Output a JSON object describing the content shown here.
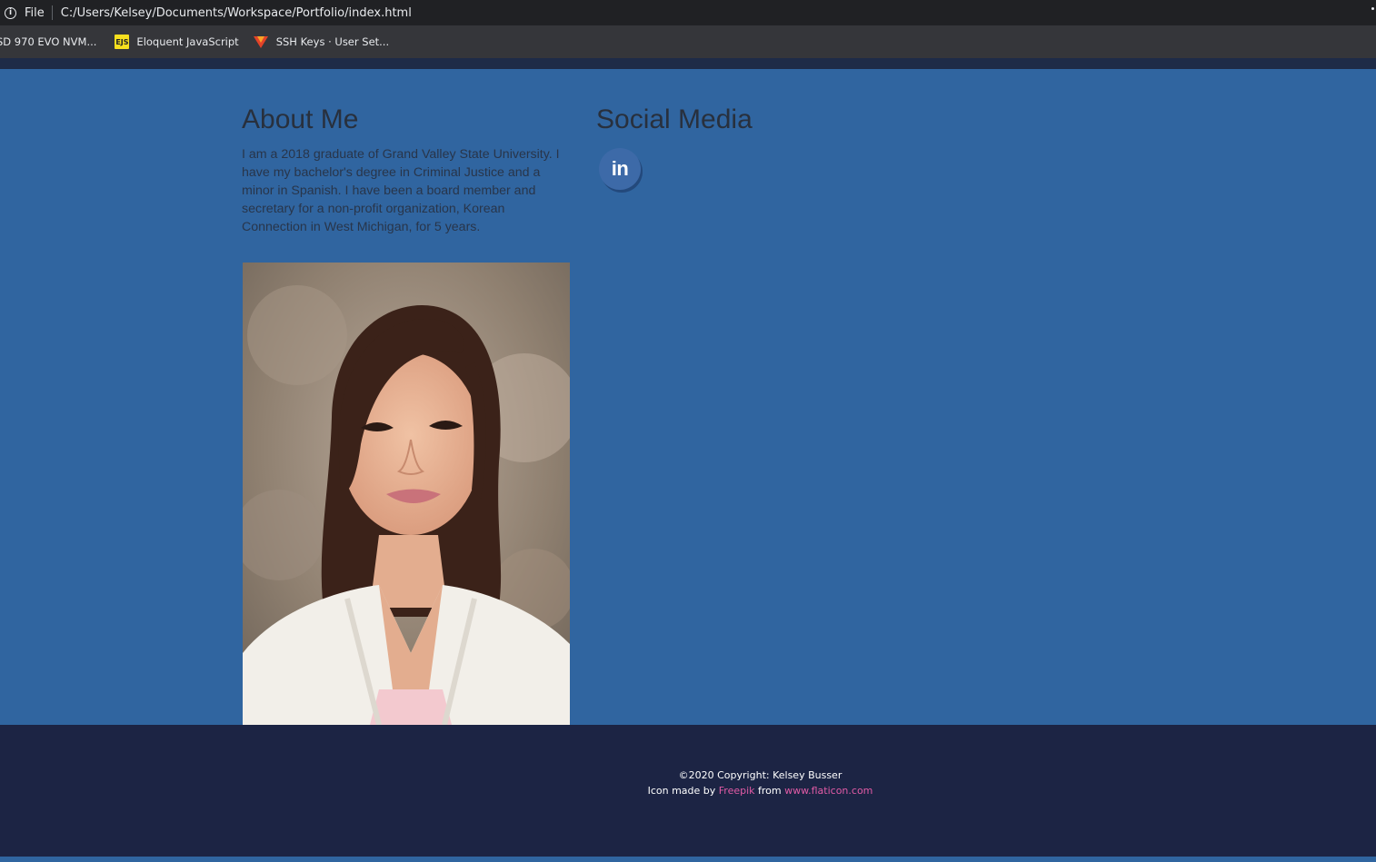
{
  "browser": {
    "file_label": "File",
    "url": "C:/Users/Kelsey/Documents/Workspace/Portfolio/index.html",
    "bookmarks": [
      {
        "label": "SD 970 EVO NVM...",
        "icon": "none"
      },
      {
        "label": "Eloquent JavaScript",
        "icon": "ejs-icon",
        "icon_text": "EJS"
      },
      {
        "label": "SSH Keys · User Set...",
        "icon": "gitlab-icon"
      }
    ]
  },
  "about": {
    "heading": "About Me",
    "body": "I am a 2018 graduate of Grand Valley State University. I have my bachelor's degree in Criminal Justice and a minor in Spanish. I have been a board member and secretary for a non-profit organization, Korean Connection in West Michigan, for 5 years."
  },
  "social": {
    "heading": "Social Media",
    "linkedin_glyph": "in"
  },
  "footer": {
    "copyright": "©2020 Copyright: Kelsey Busser",
    "credit_prefix": "Icon made by",
    "credit_author": "Freepik",
    "credit_mid": "from",
    "credit_site": "www.flaticon.com"
  },
  "colors": {
    "page_bg": "#3065a0",
    "footer_bg": "#1c2444",
    "link": "#e25ba6"
  }
}
